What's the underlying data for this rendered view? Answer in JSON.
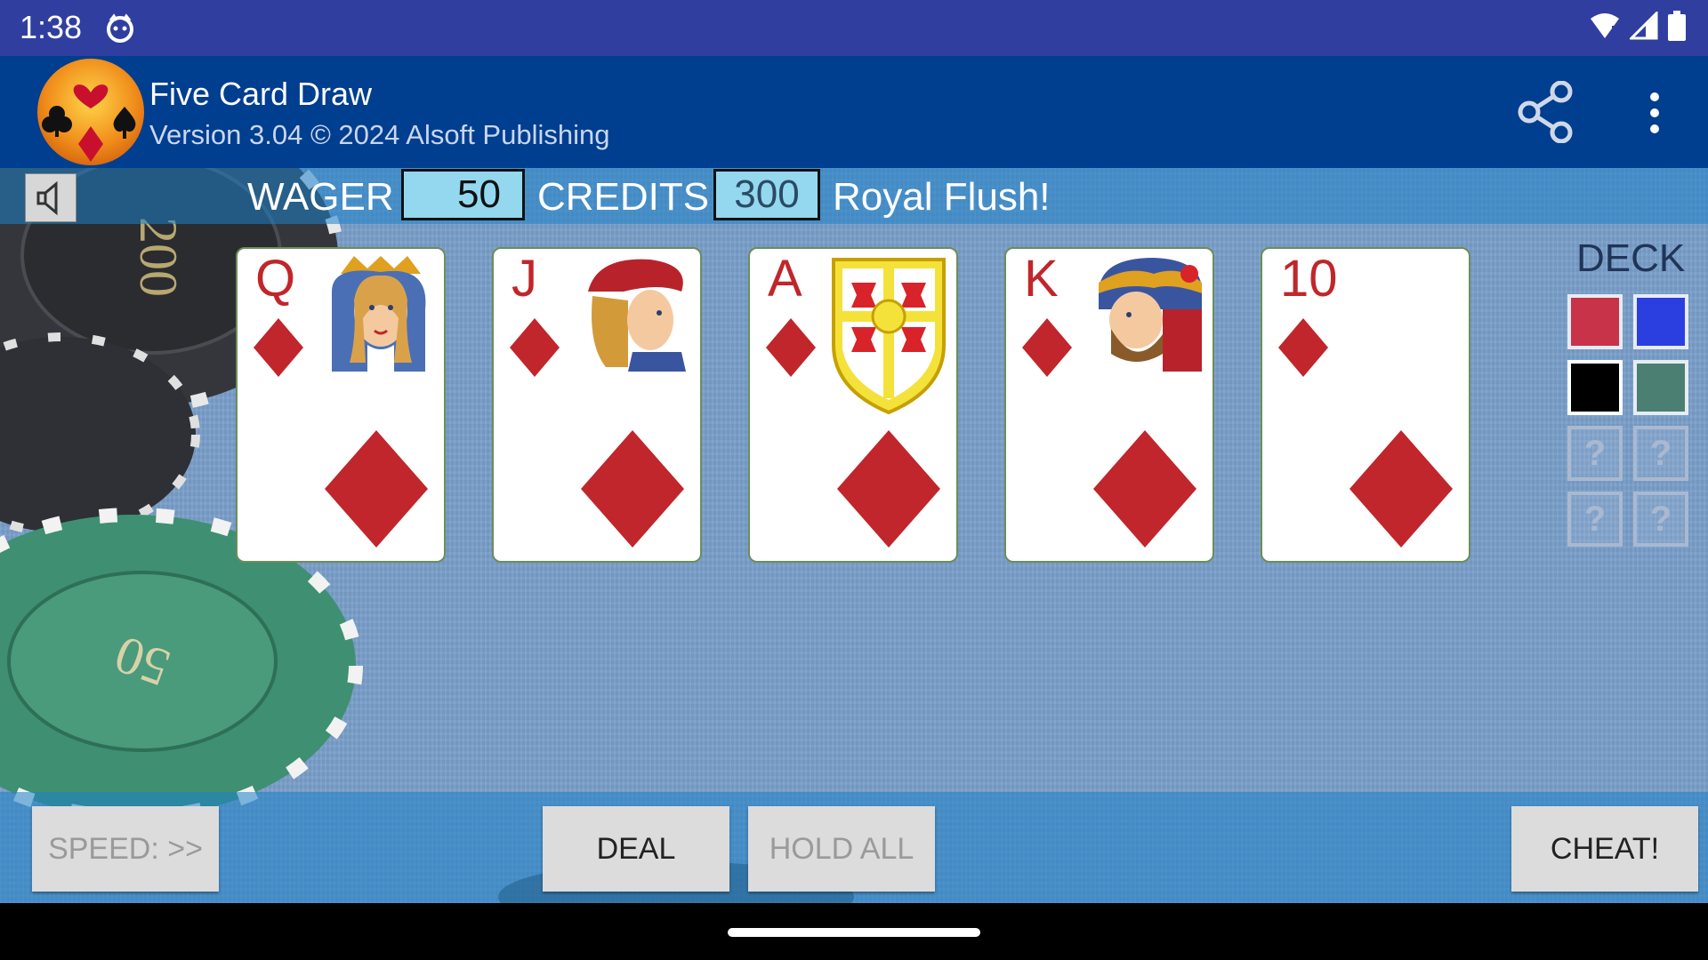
{
  "status_bar": {
    "time": "1:38"
  },
  "app_bar": {
    "title": "Five Card Draw",
    "subtitle": "Version 3.04 © 2024 Alsoft Publishing"
  },
  "game": {
    "wager_label": "WAGER",
    "wager_value": "50",
    "credits_label": "CREDITS",
    "credits_value": "300",
    "result_text": "Royal Flush!",
    "chips": [
      {
        "label": "200",
        "color": "#3d3f44"
      },
      {
        "label": "50",
        "color": "#3f8f72"
      }
    ],
    "cards": [
      {
        "rank": "Q",
        "suit": "diamonds",
        "face": "queen"
      },
      {
        "rank": "J",
        "suit": "diamonds",
        "face": "jack"
      },
      {
        "rank": "A",
        "suit": "diamonds",
        "face": "shield"
      },
      {
        "rank": "K",
        "suit": "diamonds",
        "face": "king"
      },
      {
        "rank": "10",
        "suit": "diamonds",
        "face": "none"
      }
    ],
    "deck_label": "DECK",
    "deck_options": [
      {
        "color": "#c8334a"
      },
      {
        "color": "#2b3fe0"
      },
      {
        "color": "#000000",
        "selected": true
      },
      {
        "color": "#4b7f71"
      },
      {
        "label": "?"
      },
      {
        "label": "?"
      },
      {
        "label": "?"
      },
      {
        "label": "?"
      }
    ]
  },
  "buttons": {
    "speed_label": "SPEED: >>",
    "deal_label": "DEAL",
    "hold_all_label": "HOLD ALL",
    "cheat_label": "CHEAT!"
  },
  "colors": {
    "status_bar": "#303f9f",
    "app_bar": "#003e8f",
    "felt": "#7a9fca",
    "card_red": "#c0262b"
  }
}
